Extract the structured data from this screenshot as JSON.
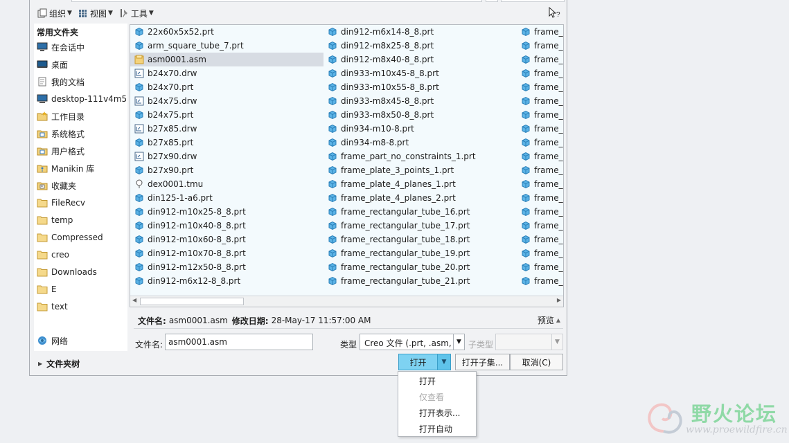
{
  "toolbar": {
    "organize": "组织",
    "view": "视图",
    "tools": "工具"
  },
  "sidebar": {
    "header": "常用文件夹",
    "items": [
      {
        "label": "在会话中",
        "icon": "monitor-icon"
      },
      {
        "label": "桌面",
        "icon": "desktop-icon"
      },
      {
        "label": "我的文档",
        "icon": "documents-icon"
      },
      {
        "label": "desktop-111v4m5",
        "icon": "computer-icon"
      },
      {
        "label": "工作目录",
        "icon": "working-directory-icon"
      },
      {
        "label": "系统格式",
        "icon": "system-format-icon"
      },
      {
        "label": "用户格式",
        "icon": "user-format-icon"
      },
      {
        "label": "Manikin 库",
        "icon": "manikin-library-icon"
      },
      {
        "label": "收藏夹",
        "icon": "favorites-icon"
      },
      {
        "label": "FileRecv",
        "icon": "folder-icon"
      },
      {
        "label": "temp",
        "icon": "folder-icon"
      },
      {
        "label": "Compressed",
        "icon": "folder-icon"
      },
      {
        "label": "creo",
        "icon": "folder-icon"
      },
      {
        "label": "Downloads",
        "icon": "folder-icon"
      },
      {
        "label": "E",
        "icon": "folder-icon"
      },
      {
        "label": "text",
        "icon": "folder-icon"
      }
    ],
    "network": "网络",
    "folder_tree": "文件夹树"
  },
  "files": {
    "col1": [
      {
        "name": "22x60x5x52.prt",
        "type": "prt"
      },
      {
        "name": "arm_square_tube_7.prt",
        "type": "prt"
      },
      {
        "name": "asm0001.asm",
        "type": "asm",
        "selected": true
      },
      {
        "name": "b24x70.drw",
        "type": "drw"
      },
      {
        "name": "b24x70.prt",
        "type": "prt"
      },
      {
        "name": "b24x75.drw",
        "type": "drw"
      },
      {
        "name": "b24x75.prt",
        "type": "prt"
      },
      {
        "name": "b27x85.drw",
        "type": "drw"
      },
      {
        "name": "b27x85.prt",
        "type": "prt"
      },
      {
        "name": "b27x90.drw",
        "type": "drw"
      },
      {
        "name": "b27x90.prt",
        "type": "prt"
      },
      {
        "name": "dex0001.tmu",
        "type": "tmu"
      },
      {
        "name": "din125-1-a6.prt",
        "type": "prt"
      },
      {
        "name": "din912-m10x25-8_8.prt",
        "type": "prt"
      },
      {
        "name": "din912-m10x40-8_8.prt",
        "type": "prt"
      },
      {
        "name": "din912-m10x60-8_8.prt",
        "type": "prt"
      },
      {
        "name": "din912-m10x70-8_8.prt",
        "type": "prt"
      },
      {
        "name": "din912-m12x50-8_8.prt",
        "type": "prt"
      },
      {
        "name": "din912-m6x12-8_8.prt",
        "type": "prt"
      }
    ],
    "col2": [
      {
        "name": "din912-m6x14-8_8.prt",
        "type": "prt"
      },
      {
        "name": "din912-m8x25-8_8.prt",
        "type": "prt"
      },
      {
        "name": "din912-m8x40-8_8.prt",
        "type": "prt"
      },
      {
        "name": "din933-m10x45-8_8.prt",
        "type": "prt"
      },
      {
        "name": "din933-m10x55-8_8.prt",
        "type": "prt"
      },
      {
        "name": "din933-m8x45-8_8.prt",
        "type": "prt"
      },
      {
        "name": "din933-m8x50-8_8.prt",
        "type": "prt"
      },
      {
        "name": "din934-m10-8.prt",
        "type": "prt"
      },
      {
        "name": "din934-m8-8.prt",
        "type": "prt"
      },
      {
        "name": "frame_part_no_constraints_1.prt",
        "type": "prt"
      },
      {
        "name": "frame_plate_3_points_1.prt",
        "type": "prt"
      },
      {
        "name": "frame_plate_4_planes_1.prt",
        "type": "prt"
      },
      {
        "name": "frame_plate_4_planes_2.prt",
        "type": "prt"
      },
      {
        "name": "frame_rectangular_tube_16.prt",
        "type": "prt"
      },
      {
        "name": "frame_rectangular_tube_17.prt",
        "type": "prt"
      },
      {
        "name": "frame_rectangular_tube_18.prt",
        "type": "prt"
      },
      {
        "name": "frame_rectangular_tube_19.prt",
        "type": "prt"
      },
      {
        "name": "frame_rectangular_tube_20.prt",
        "type": "prt"
      },
      {
        "name": "frame_rectangular_tube_21.prt",
        "type": "prt"
      }
    ],
    "col3": [
      {
        "name": "frame_",
        "type": "prt"
      },
      {
        "name": "frame_",
        "type": "prt"
      },
      {
        "name": "frame_",
        "type": "prt"
      },
      {
        "name": "frame_",
        "type": "prt"
      },
      {
        "name": "frame_",
        "type": "prt"
      },
      {
        "name": "frame_",
        "type": "prt"
      },
      {
        "name": "frame_",
        "type": "prt"
      },
      {
        "name": "frame_",
        "type": "prt"
      },
      {
        "name": "frame_",
        "type": "prt"
      },
      {
        "name": "frame_",
        "type": "prt"
      },
      {
        "name": "frame_",
        "type": "prt"
      },
      {
        "name": "frame_",
        "type": "prt"
      },
      {
        "name": "frame_",
        "type": "prt"
      },
      {
        "name": "frame_",
        "type": "prt"
      },
      {
        "name": "frame_",
        "type": "prt"
      },
      {
        "name": "frame_",
        "type": "prt"
      },
      {
        "name": "frame_",
        "type": "prt"
      },
      {
        "name": "frame_",
        "type": "prt"
      },
      {
        "name": "frame_",
        "type": "prt"
      }
    ]
  },
  "info": {
    "filename_label": "文件名:",
    "filename": "asm0001.asm",
    "modified_label": "修改日期:",
    "modified": "28-May-17 11:57:00 AM",
    "preview": "预览"
  },
  "form": {
    "filename_label": "文件名:",
    "filename_value": "asm0001.asm",
    "type_label": "类型",
    "type_value": "Creo 文件 (.prt, .asm,",
    "subtype_label": "子类型"
  },
  "buttons": {
    "open": "打开",
    "open_subset": "打开子集...",
    "cancel": "取消(C)"
  },
  "open_menu": [
    {
      "label": "打开",
      "enabled": true
    },
    {
      "label": "仅查看",
      "enabled": false
    },
    {
      "label": "打开表示...",
      "enabled": true
    },
    {
      "label": "打开自动",
      "enabled": true
    }
  ],
  "watermark": {
    "title": "野火论坛",
    "url": "www.proewildfire.cn"
  }
}
